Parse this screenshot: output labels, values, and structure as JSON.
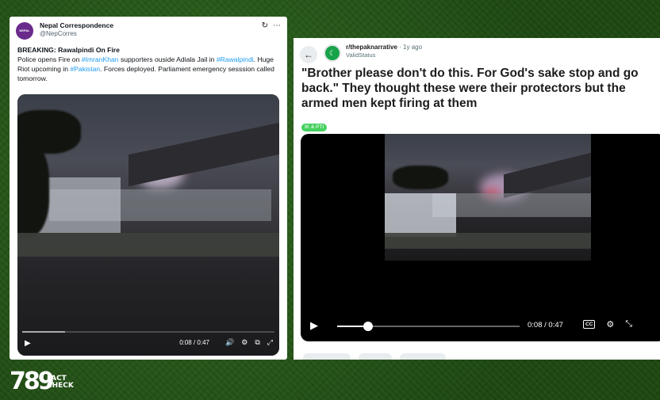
{
  "tweet": {
    "avatar_text": "NEPAL",
    "name": "Nepal Correspondence",
    "handle": "@NepCorres",
    "headline": "BREAKING: Rawalpindi On Fire",
    "text_part1": "Police opens Fire on ",
    "tag1": "#ImranKhan",
    "text_part2": " supporters ouside Adiala Jail in ",
    "tag2": "#Rawalpindi",
    "text_part3": ". Huge Riot upcoming in ",
    "tag3": "#Pakistan",
    "text_part4": ". Forces deployed. Parliament emergency sesssion called tomorrow.",
    "video_time": "0:08 / 0:47",
    "video_progress": 0.17,
    "icons": [
      "refresh-icon",
      "more-icon",
      "play-icon",
      "volume-icon",
      "settings-icon",
      "pip-icon",
      "fullscreen-icon"
    ]
  },
  "reddit": {
    "subreddit": "r/thepaknarrative",
    "age": "1y ago",
    "user": "ValidStatus",
    "title": "\"Brother please don't do this. For God's sake stop and go back.\" They thought these were their protectors but the armed men kept firing at them",
    "flair": "IK & PTI",
    "video_time": "0:08 / 0:47",
    "video_progress": 0.17,
    "cc_label": "CC",
    "icons": [
      "back-arrow-icon",
      "subreddit-icon",
      "play-icon",
      "cc-icon",
      "settings-icon",
      "expand-icon"
    ]
  },
  "logo": {
    "number": "789",
    "word1": "FACT",
    "word2": "CHECK"
  },
  "colors": {
    "twitter_link": "#1d9bf0",
    "reddit_flair": "#46d160",
    "background_green": "#1f4a14"
  }
}
